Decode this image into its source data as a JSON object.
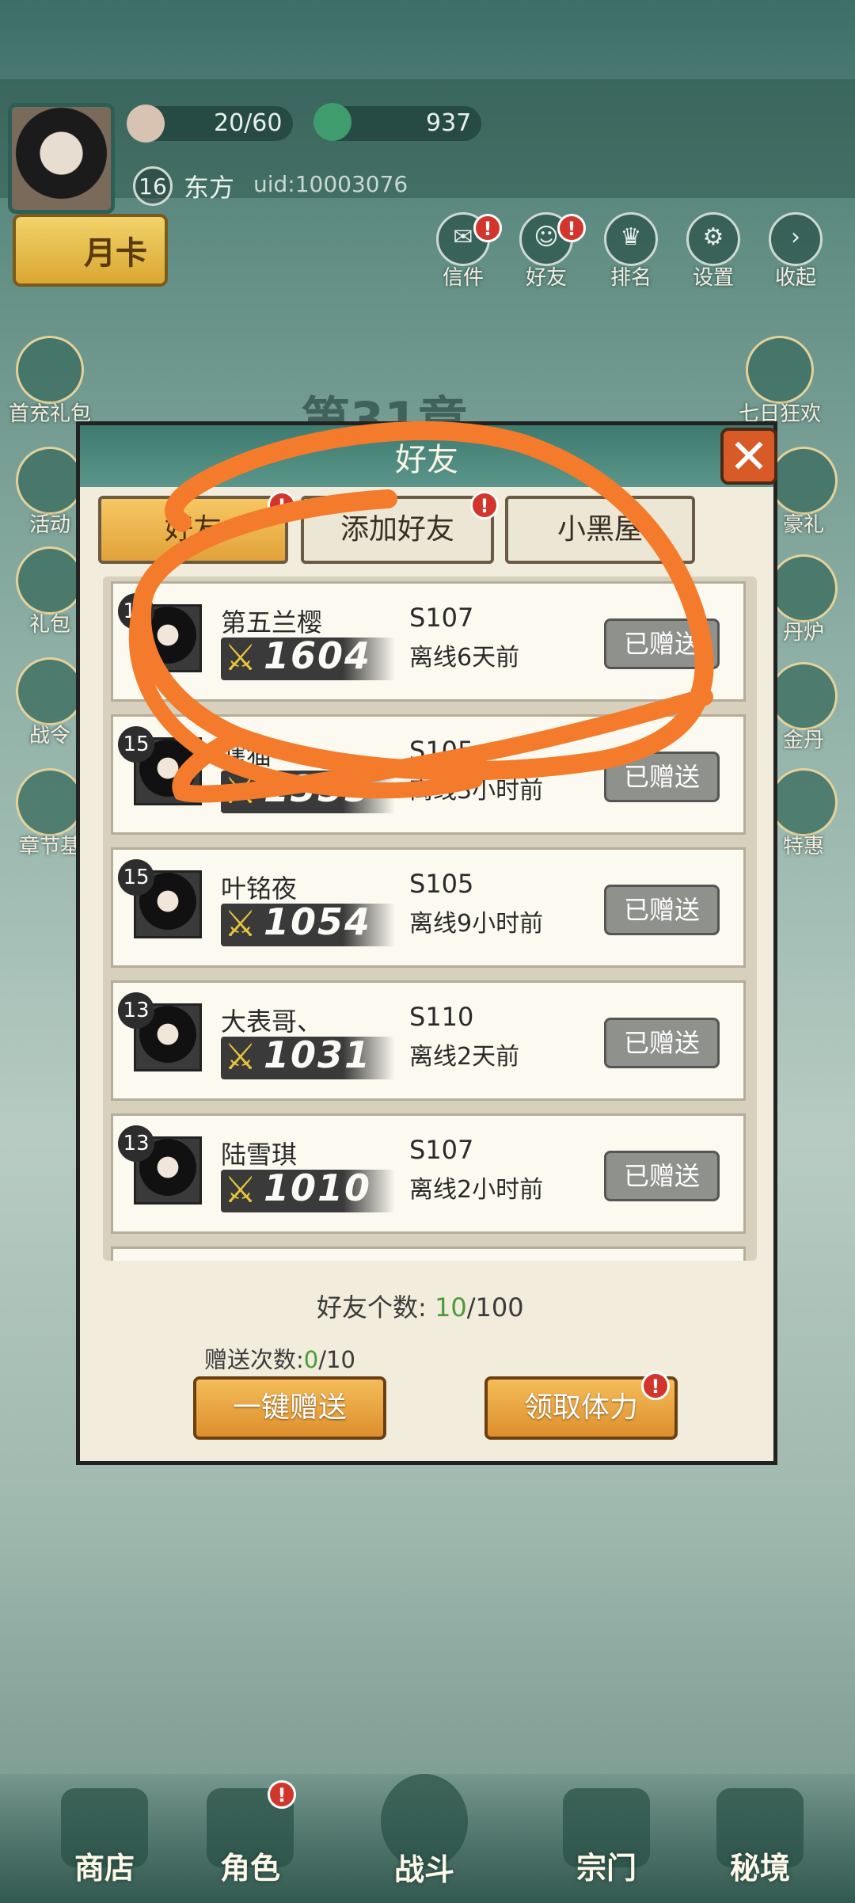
{
  "hud": {
    "stamina": "20/60",
    "currency": "937",
    "level": "16",
    "player_name": "东方",
    "uid": "uid:10003076",
    "month_card": "月卡"
  },
  "top_menu": [
    {
      "label": "信件",
      "badge": "!"
    },
    {
      "label": "好友",
      "badge": "!"
    },
    {
      "label": "排名",
      "badge": ""
    },
    {
      "label": "设置",
      "badge": ""
    },
    {
      "label": "收起",
      "badge": ""
    }
  ],
  "left_side": [
    "首充礼包",
    "活动",
    "礼包",
    "战令",
    "章节基"
  ],
  "right_side": [
    "七日狂欢",
    "豪礼",
    "丹炉",
    "金丹",
    "特惠"
  ],
  "chapter_title": "第31章",
  "dialog": {
    "title": "好友",
    "close": "✕",
    "tabs": [
      {
        "label": "好友",
        "badge": "!"
      },
      {
        "label": "添加好友",
        "badge": "!"
      },
      {
        "label": "小黑屋",
        "badge": ""
      }
    ],
    "friends": [
      {
        "level": "15",
        "name": "第五兰樱",
        "power": "1604",
        "server": "S107",
        "offline": "离线6天前",
        "button": "已赠送"
      },
      {
        "level": "15",
        "name": "瞎猫",
        "power": "1355",
        "server": "S105",
        "offline": "离线3小时前",
        "button": "已赠送"
      },
      {
        "level": "15",
        "name": "叶铭夜",
        "power": "1054",
        "server": "S105",
        "offline": "离线9小时前",
        "button": "已赠送"
      },
      {
        "level": "13",
        "name": "大表哥、",
        "power": "1031",
        "server": "S110",
        "offline": "离线2天前",
        "button": "已赠送"
      },
      {
        "level": "13",
        "name": "陆雪琪",
        "power": "1010",
        "server": "S107",
        "offline": "离线2小时前",
        "button": "已赠送"
      }
    ],
    "friend_count_label": "好友个数:",
    "friend_count_current": "10",
    "friend_count_max": "/100",
    "gift_count_label": "赠送次数:",
    "gift_count_current": "0",
    "gift_count_max": "/10",
    "gift_all_button": "一键赠送",
    "claim_button": "领取体力",
    "claim_badge": "!"
  },
  "bottom_nav": [
    "商店",
    "角色",
    "战斗",
    "宗门",
    "秘境"
  ],
  "bottom_nav_badge": "!",
  "colors": {
    "accent": "#f07a2a",
    "tab_active": "#f2b957",
    "button_gray": "#8f918d"
  }
}
